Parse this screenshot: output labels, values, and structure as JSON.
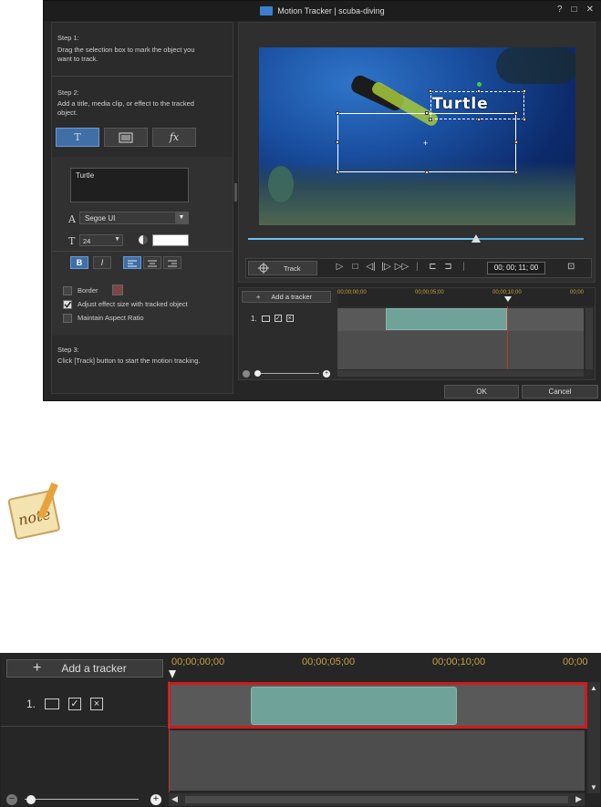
{
  "dialog": {
    "title": "Motion Tracker | scuba-diving",
    "help": "?",
    "maximize": "□",
    "close": "✕",
    "step1_title": "Step 1:",
    "step1_text": "Drag the selection box to mark the object you want to track.",
    "step2_title": "Step 2:",
    "step2_text": "Add a title, media clip, or effect to the tracked object.",
    "tab_title": "T",
    "tab_fx": "fx",
    "title_text": "Turtle",
    "font_name": "Segoe UI",
    "font_size": "24",
    "bold": "B",
    "italic": "I",
    "border_label": "Border",
    "adjust_label": "Adjust effect size with tracked object",
    "aspect_label": "Maintain Aspect Ratio",
    "step3_title": "Step 3:",
    "step3_text": "Click [Track] button to start the motion tracking.",
    "overlay_text": "Turtle",
    "track_label": "Track",
    "timecode": "00; 00; 11; 00",
    "add_tracker": "Add a tracker",
    "ruler": [
      "00;00;00;00",
      "00;00;05;00",
      "00;00;10;00",
      "00;00"
    ],
    "track_num": "1.",
    "ok": "OK",
    "cancel": "Cancel",
    "progress_fraction": 0.68
  },
  "zoom": {
    "add_tracker": "Add a tracker",
    "ruler": [
      "00;00;00;00",
      "00;00;05;00",
      "00;00;10;00",
      "00;00"
    ],
    "track_num": "1."
  },
  "colors": {
    "clip": "#6fa39a",
    "playhead": "#c0392b",
    "highlight": "#d11a1a",
    "accent": "#3f6fa6"
  }
}
